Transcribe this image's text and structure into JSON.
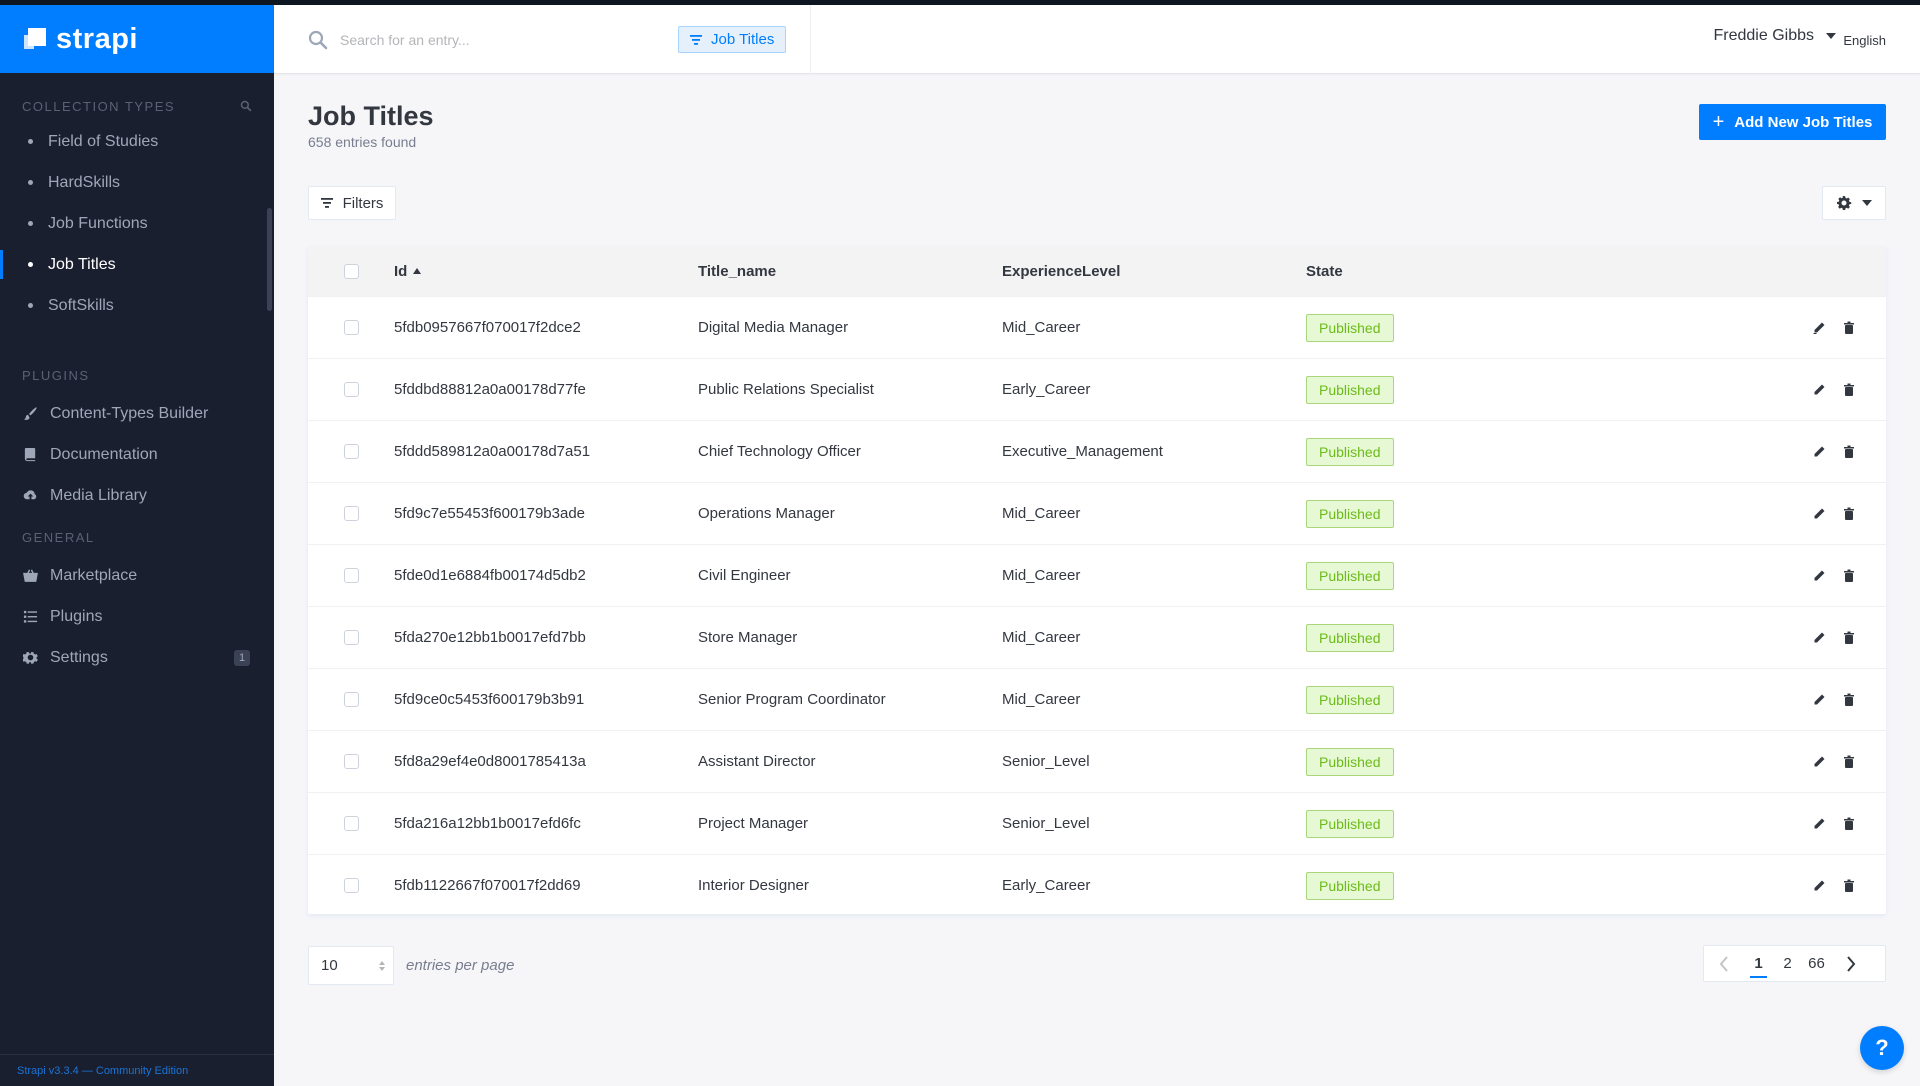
{
  "brand": {
    "name": "strapi"
  },
  "sidebar": {
    "collection_types_title": "COLLECTION TYPES",
    "collection_items": [
      {
        "label": "Field of Studies",
        "active": false
      },
      {
        "label": "HardSkills",
        "active": false
      },
      {
        "label": "Job Functions",
        "active": false
      },
      {
        "label": "Job Titles",
        "active": true
      },
      {
        "label": "SoftSkills",
        "active": false
      }
    ],
    "plugins_title": "PLUGINS",
    "plugin_items": [
      {
        "label": "Content-Types Builder",
        "icon": "paintbrush-icon"
      },
      {
        "label": "Documentation",
        "icon": "book-icon"
      },
      {
        "label": "Media Library",
        "icon": "cloud-upload-icon"
      }
    ],
    "general_title": "GENERAL",
    "general_items": [
      {
        "label": "Marketplace",
        "icon": "basket-icon"
      },
      {
        "label": "Plugins",
        "icon": "list-icon"
      },
      {
        "label": "Settings",
        "icon": "gear-icon",
        "badge": "1"
      }
    ],
    "footer": "Strapi v3.3.4 — Community Edition"
  },
  "header": {
    "search_placeholder": "Search for an entry...",
    "search_scope": "Job Titles",
    "user_name": "Freddie Gibbs",
    "language": "English"
  },
  "main": {
    "title": "Job Titles",
    "subtitle": "658 entries found",
    "add_button": "Add New Job Titles",
    "filters_button": "Filters",
    "columns": {
      "id": "Id",
      "title": "Title_name",
      "experience": "ExperienceLevel",
      "state": "State"
    },
    "rows": [
      {
        "id": "5fdb0957667f070017f2dce2",
        "title": "Digital Media Manager",
        "experience": "Mid_Career",
        "state": "Published"
      },
      {
        "id": "5fddbd88812a0a00178d77fe",
        "title": "Public Relations Specialist",
        "experience": "Early_Career",
        "state": "Published"
      },
      {
        "id": "5fddd589812a0a00178d7a51",
        "title": "Chief Technology Officer",
        "experience": "Executive_Management",
        "state": "Published"
      },
      {
        "id": "5fd9c7e55453f600179b3ade",
        "title": "Operations Manager",
        "experience": "Mid_Career",
        "state": "Published"
      },
      {
        "id": "5fde0d1e6884fb00174d5db2",
        "title": "Civil Engineer",
        "experience": "Mid_Career",
        "state": "Published"
      },
      {
        "id": "5fda270e12bb1b0017efd7bb",
        "title": "Store Manager",
        "experience": "Mid_Career",
        "state": "Published"
      },
      {
        "id": "5fd9ce0c5453f600179b3b91",
        "title": "Senior Program Coordinator",
        "experience": "Mid_Career",
        "state": "Published"
      },
      {
        "id": "5fd8a29ef4e0d8001785413a",
        "title": "Assistant Director",
        "experience": "Senior_Level",
        "state": "Published"
      },
      {
        "id": "5fda216a12bb1b0017efd6fc",
        "title": "Project Manager",
        "experience": "Senior_Level",
        "state": "Published"
      },
      {
        "id": "5fdb1122667f070017f2dd69",
        "title": "Interior Designer",
        "experience": "Early_Career",
        "state": "Published"
      }
    ],
    "per_page_value": "10",
    "per_page_label": "entries per page",
    "pages": [
      "1",
      "2",
      "66"
    ],
    "current_page": "1"
  },
  "colors": {
    "accent": "#007eff",
    "sidebar_bg": "#1a1f2f",
    "published_bg": "#e6f8d4",
    "published_text": "#6dbb1a"
  },
  "help_button": "?"
}
